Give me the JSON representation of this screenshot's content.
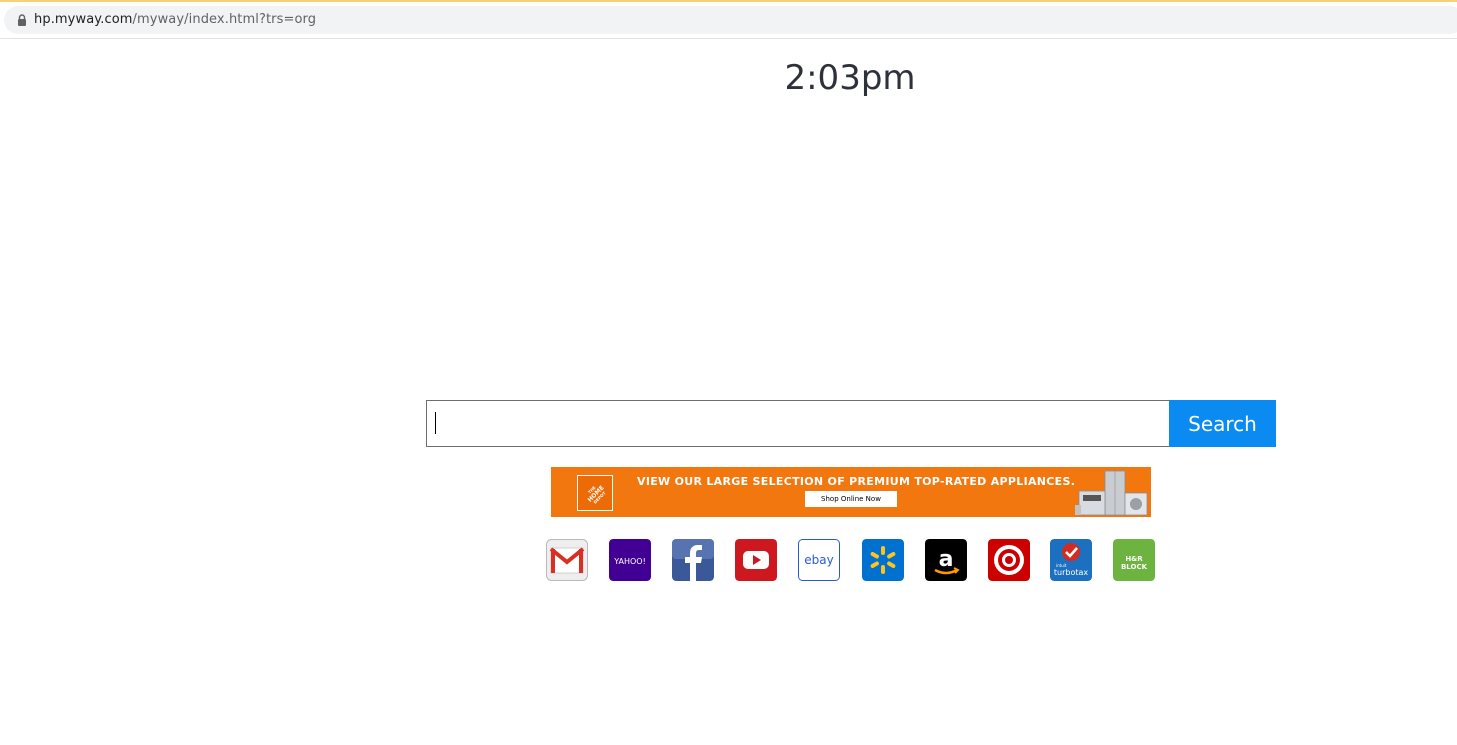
{
  "browser": {
    "url_host": "hp.myway.com",
    "url_path": "/myway/index.html?trs=org"
  },
  "clock": {
    "time": "2:03pm"
  },
  "search": {
    "value": "",
    "button_label": "Search"
  },
  "banner": {
    "headline": "VIEW OUR LARGE SELECTION OF PREMIUM TOP-RATED APPLIANCES.",
    "cta": "Shop Online Now",
    "logo_text": "THE HOME DEPOT",
    "bg_color": "#f3770f"
  },
  "quick_links": [
    {
      "name": "gmail",
      "icon": "gmail-icon"
    },
    {
      "name": "yahoo",
      "icon": "yahoo-icon",
      "label": "YAHOO!"
    },
    {
      "name": "facebook",
      "icon": "facebook-icon"
    },
    {
      "name": "youtube",
      "icon": "youtube-icon"
    },
    {
      "name": "ebay",
      "icon": "ebay-icon",
      "label": "ebay"
    },
    {
      "name": "walmart",
      "icon": "walmart-icon"
    },
    {
      "name": "amazon",
      "icon": "amazon-icon",
      "label": "a"
    },
    {
      "name": "target",
      "icon": "target-icon"
    },
    {
      "name": "turbotax",
      "icon": "turbotax-icon",
      "label": "turbotax",
      "sublabel": "intuit"
    },
    {
      "name": "hrblock",
      "icon": "hrblock-icon",
      "label": "H&R BLOCK"
    }
  ],
  "colors": {
    "search_button": "#0b8bf2",
    "clock_text": "#2d3139"
  }
}
